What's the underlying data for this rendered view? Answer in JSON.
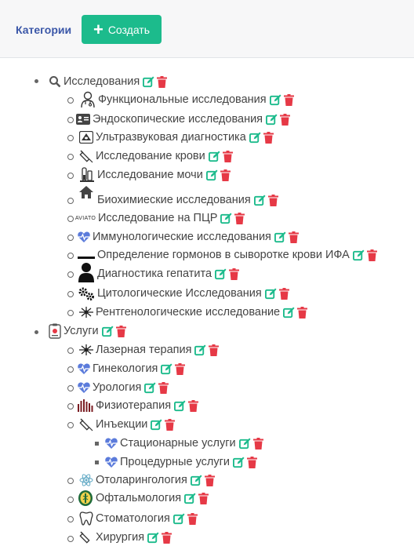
{
  "header": {
    "title": "Категории",
    "create_label": "Создать"
  },
  "tree": {
    "research": {
      "label": "Исследования",
      "children": [
        "Функциональные исследования",
        "Эндоскопические исследования",
        "Ультразвуковая диагностика",
        "Исследование крови",
        "Исследование мочи",
        "Биохимиеские исследования",
        "Исследование на ПЦР",
        "Иммунологические исследования",
        "Определение гормонов в сыворотке крови ИФА",
        "Диагностика гепатита",
        "Цитологические Исследования",
        "Рентгенологические исследование"
      ]
    },
    "services": {
      "label": "Услуги",
      "children": [
        "Лазерная терапия",
        "Гинекология",
        "Урология",
        "Физиотерапия",
        "Инъекции",
        "Стационарные услуги",
        "Процедурные услуги",
        "Отоларингология",
        "Офтальмология",
        "Стоматология",
        "Хирургия"
      ]
    }
  },
  "icon_text": {
    "pcr_logo": "AVIATO"
  },
  "colors": {
    "edit": "#1cbb8c",
    "delete": "#e63946",
    "heart": "#5b7bdb",
    "title": "#3b57a8"
  }
}
